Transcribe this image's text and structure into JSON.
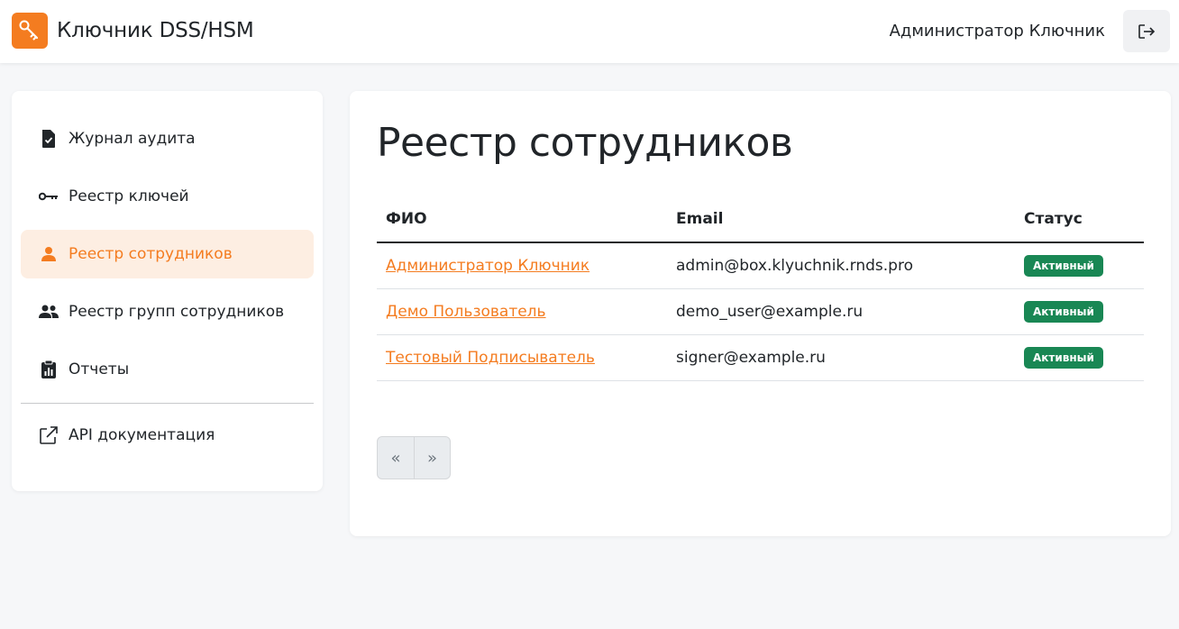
{
  "header": {
    "app_title": "Ключник DSS/HSM",
    "user_name": "Администратор Ключник"
  },
  "sidebar": {
    "items": [
      {
        "label": "Журнал аудита",
        "icon": "file-check-icon",
        "active": false
      },
      {
        "label": "Реестр ключей",
        "icon": "key-icon",
        "active": false
      },
      {
        "label": "Реестр сотрудников",
        "icon": "user-icon",
        "active": true
      },
      {
        "label": "Реестр групп сотрудников",
        "icon": "users-icon",
        "active": false
      },
      {
        "label": "Отчеты",
        "icon": "clipboard-data-icon",
        "active": false
      }
    ],
    "api_link": {
      "label": "API документация",
      "icon": "external-link-icon"
    }
  },
  "main": {
    "title": "Реестр сотрудников",
    "table": {
      "columns": [
        "ФИО",
        "Email",
        "Статус"
      ],
      "rows": [
        {
          "name": "Администратор Ключник",
          "email": "admin@box.klyuchnik.rnds.pro",
          "status": "Активный"
        },
        {
          "name": "Демо Пользователь",
          "email": "demo_user@example.ru",
          "status": "Активный"
        },
        {
          "name": "Тестовый Подписыватель",
          "email": "signer@example.ru",
          "status": "Активный"
        }
      ]
    },
    "pagination": {
      "prev": "«",
      "next": "»"
    }
  },
  "colors": {
    "accent": "#f47c20",
    "active_bg": "#fdeee2",
    "status_active": "#198754"
  }
}
